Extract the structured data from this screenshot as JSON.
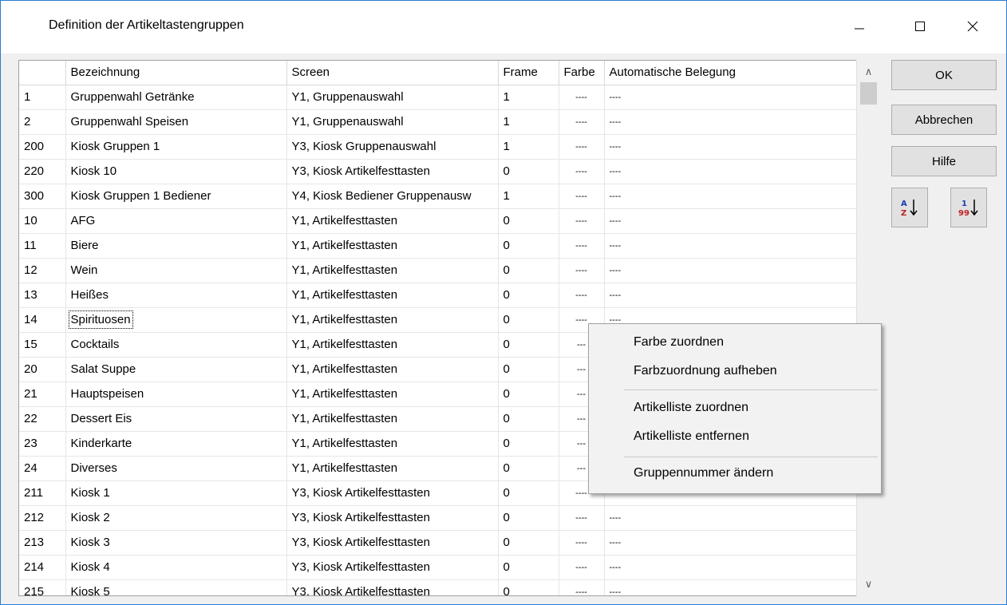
{
  "window": {
    "title": "Definition der Artikeltastengruppen"
  },
  "table": {
    "headers": {
      "num": "",
      "bezeichnung": "Bezeichnung",
      "screen": "Screen",
      "frame": "Frame",
      "farbe": "Farbe",
      "auto": "Automatische Belegung"
    },
    "rows": [
      {
        "num": "1",
        "bez": "Gruppenwahl Getränke",
        "screen": "Y1, Gruppenauswahl",
        "frame": "1",
        "farbe": "----",
        "auto": "----"
      },
      {
        "num": "2",
        "bez": "Gruppenwahl Speisen",
        "screen": "Y1, Gruppenauswahl",
        "frame": "1",
        "farbe": "----",
        "auto": "----"
      },
      {
        "num": "200",
        "bez": "Kiosk Gruppen 1",
        "screen": "Y3, Kiosk Gruppenauswahl",
        "frame": "1",
        "farbe": "----",
        "auto": "----"
      },
      {
        "num": "220",
        "bez": "Kiosk 10",
        "screen": "Y3, Kiosk Artikelfesttasten",
        "frame": "0",
        "farbe": "----",
        "auto": "----"
      },
      {
        "num": "300",
        "bez": "Kiosk Gruppen 1 Bediener",
        "screen": "Y4, Kiosk Bediener Gruppenausw",
        "frame": "1",
        "farbe": "----",
        "auto": "----"
      },
      {
        "num": "10",
        "bez": "AFG",
        "screen": "Y1, Artikelfesttasten",
        "frame": "0",
        "farbe": "----",
        "auto": "----"
      },
      {
        "num": "11",
        "bez": "Biere",
        "screen": "Y1, Artikelfesttasten",
        "frame": "0",
        "farbe": "----",
        "auto": "----"
      },
      {
        "num": "12",
        "bez": "Wein",
        "screen": "Y1, Artikelfesttasten",
        "frame": "0",
        "farbe": "----",
        "auto": "----"
      },
      {
        "num": "13",
        "bez": "Heißes",
        "screen": "Y1, Artikelfesttasten",
        "frame": "0",
        "farbe": "----",
        "auto": "----"
      },
      {
        "num": "14",
        "bez": "Spirituosen",
        "screen": "Y1, Artikelfesttasten",
        "frame": "0",
        "farbe": "----",
        "auto": "----"
      },
      {
        "num": "15",
        "bez": "Cocktails",
        "screen": "Y1, Artikelfesttasten",
        "frame": "0",
        "farbe": "---",
        "auto": ""
      },
      {
        "num": "20",
        "bez": "Salat Suppe",
        "screen": "Y1, Artikelfesttasten",
        "frame": "0",
        "farbe": "---",
        "auto": ""
      },
      {
        "num": "21",
        "bez": "Hauptspeisen",
        "screen": "Y1, Artikelfesttasten",
        "frame": "0",
        "farbe": "---",
        "auto": ""
      },
      {
        "num": "22",
        "bez": "Dessert Eis",
        "screen": "Y1, Artikelfesttasten",
        "frame": "0",
        "farbe": "---",
        "auto": ""
      },
      {
        "num": "23",
        "bez": "Kinderkarte",
        "screen": "Y1, Artikelfesttasten",
        "frame": "0",
        "farbe": "---",
        "auto": ""
      },
      {
        "num": "24",
        "bez": "Diverses",
        "screen": "Y1, Artikelfesttasten",
        "frame": "0",
        "farbe": "---",
        "auto": ""
      },
      {
        "num": "211",
        "bez": "Kiosk 1",
        "screen": "Y3, Kiosk Artikelfesttasten",
        "frame": "0",
        "farbe": "----",
        "auto": "----"
      },
      {
        "num": "212",
        "bez": "Kiosk 2",
        "screen": "Y3, Kiosk Artikelfesttasten",
        "frame": "0",
        "farbe": "----",
        "auto": "----"
      },
      {
        "num": "213",
        "bez": "Kiosk 3",
        "screen": "Y3, Kiosk Artikelfesttasten",
        "frame": "0",
        "farbe": "----",
        "auto": "----"
      },
      {
        "num": "214",
        "bez": "Kiosk 4",
        "screen": "Y3, Kiosk Artikelfesttasten",
        "frame": "0",
        "farbe": "----",
        "auto": "----"
      },
      {
        "num": "215",
        "bez": "Kiosk 5",
        "screen": "Y3, Kiosk Artikelfesttasten",
        "frame": "0",
        "farbe": "----",
        "auto": "----"
      }
    ]
  },
  "buttons": {
    "ok": "OK",
    "cancel": "Abbrechen",
    "help": "Hilfe",
    "sort_alpha_icon": "sort-alpha-icon",
    "sort_numeric_icon": "sort-numeric-icon"
  },
  "context_menu": {
    "items": [
      "Farbe zuordnen",
      "Farbzuordnung aufheben",
      "Artikelliste zuordnen",
      "Artikelliste entfernen",
      "Gruppennummer ändern"
    ]
  }
}
